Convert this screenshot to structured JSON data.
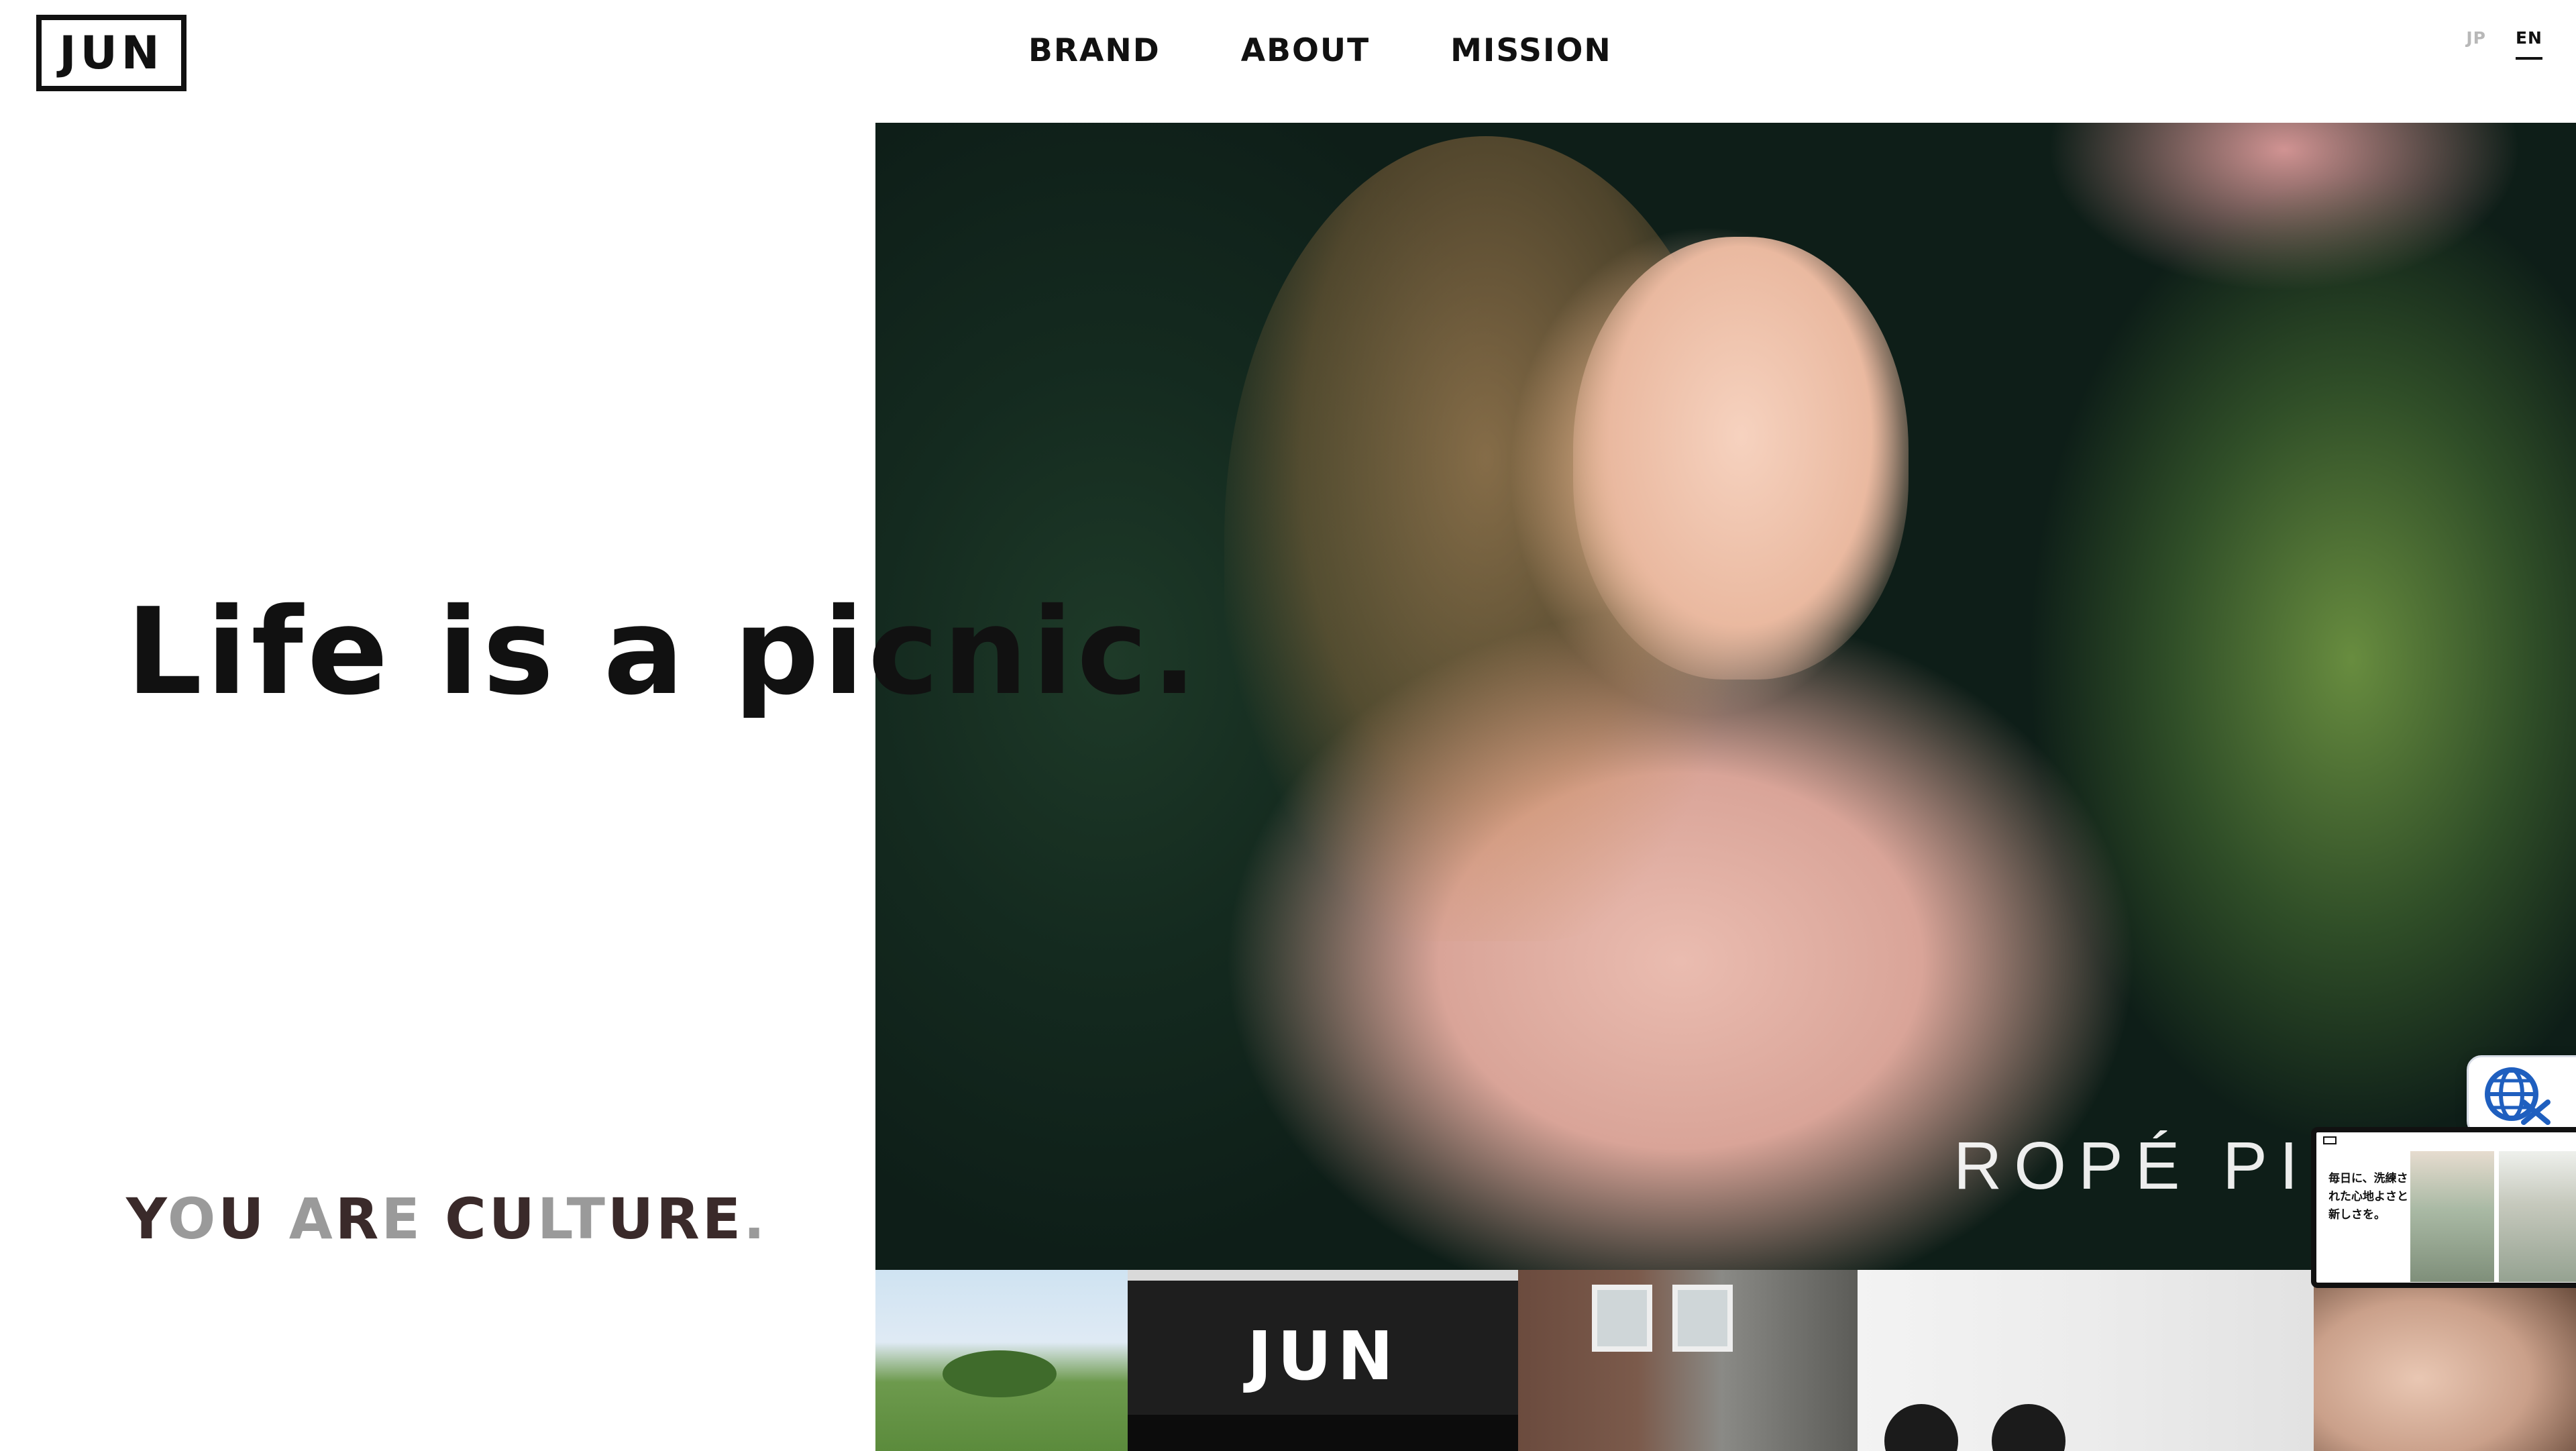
{
  "header": {
    "logo_text": "JUN",
    "nav": [
      {
        "label": "BRAND"
      },
      {
        "label": "ABOUT"
      },
      {
        "label": "MISSION"
      }
    ],
    "languages": {
      "jp": "JP",
      "en": "EN",
      "active": "EN"
    }
  },
  "hero": {
    "tagline": "Life is a picnic.",
    "brand_overlay": "ROPÉ PI",
    "culture": {
      "letters": [
        {
          "t": "Y",
          "tone": "dark"
        },
        {
          "t": "O",
          "tone": "light"
        },
        {
          "t": "U",
          "tone": "dark"
        },
        {
          "t": " ",
          "tone": "dark"
        },
        {
          "t": "A",
          "tone": "light"
        },
        {
          "t": "R",
          "tone": "dark"
        },
        {
          "t": "E",
          "tone": "light"
        },
        {
          "t": " ",
          "tone": "dark"
        },
        {
          "t": "C",
          "tone": "dark"
        },
        {
          "t": "U",
          "tone": "dark"
        },
        {
          "t": "L",
          "tone": "light"
        },
        {
          "t": "T",
          "tone": "light"
        },
        {
          "t": "U",
          "tone": "dark"
        },
        {
          "t": "R",
          "tone": "dark"
        },
        {
          "t": "E",
          "tone": "dark"
        },
        {
          "t": ".",
          "tone": "light"
        }
      ]
    }
  },
  "thumbnails": {
    "jun_store_logo": "JUN"
  },
  "preview_card": {
    "text": "毎日に、洗練された心地よさと新しさを。"
  },
  "icons": {
    "translate": "globe-translate-icon"
  },
  "colors": {
    "text": "#111111",
    "lang_inactive": "#b8b8b8",
    "culture_dark": "#3a2a2a",
    "culture_light": "#9a9a9a",
    "translate_blue": "#1f5fbf"
  }
}
